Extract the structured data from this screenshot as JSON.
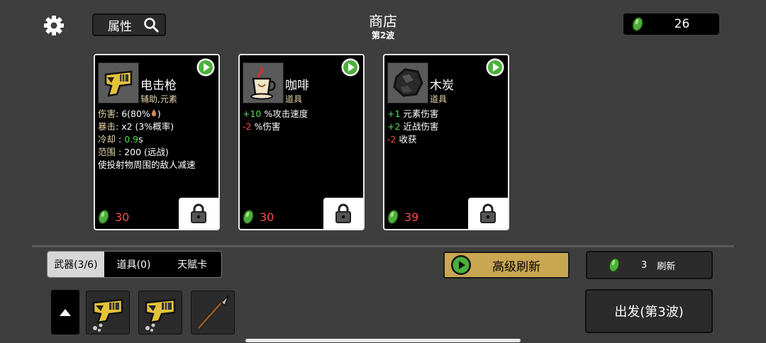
{
  "header": {
    "attributes_label": "属性",
    "title": "商店",
    "wave": "第2波",
    "materials": "26"
  },
  "cards": [
    {
      "name": "电击枪",
      "category": "辅助,元素",
      "stats": [
        {
          "parts": [
            {
              "t": "伤害",
              "c": "lbl"
            },
            {
              "t": ": 6(80%",
              "c": ""
            }
          ]
        },
        {
          "parts": [
            {
              "t": "暴击",
              "c": "lbl"
            },
            {
              "t": ": x2 (3%概率)",
              "c": ""
            }
          ]
        },
        {
          "parts": [
            {
              "t": "冷却",
              "c": "lbl"
            },
            {
              "t": " : ",
              "c": ""
            },
            {
              "t": "0.9",
              "c": "pos"
            },
            {
              "t": "s",
              "c": ""
            }
          ]
        },
        {
          "parts": [
            {
              "t": "范围",
              "c": "lbl"
            },
            {
              "t": " : 200 (远战)",
              "c": ""
            }
          ]
        },
        {
          "parts": [
            {
              "t": "使投射物周围的敌人减速",
              "c": ""
            }
          ]
        }
      ],
      "price": "30",
      "icon": "taser-icon"
    },
    {
      "name": "咖啡",
      "category": "道具",
      "stats": [
        {
          "parts": [
            {
              "t": "+10",
              "c": "pos"
            },
            {
              "t": " %攻击速度",
              "c": ""
            }
          ]
        },
        {
          "parts": [
            {
              "t": "-2",
              "c": "neg"
            },
            {
              "t": " %伤害",
              "c": ""
            }
          ]
        }
      ],
      "price": "30",
      "icon": "coffee-cup-icon"
    },
    {
      "name": "木炭",
      "category": "道具",
      "stats": [
        {
          "parts": [
            {
              "t": "+1",
              "c": "pos"
            },
            {
              "t": " 元素伤害",
              "c": ""
            }
          ]
        },
        {
          "parts": [
            {
              "t": "+2",
              "c": "pos"
            },
            {
              "t": " 近战伤害",
              "c": ""
            }
          ]
        },
        {
          "parts": [
            {
              "t": "-2",
              "c": "neg"
            },
            {
              "t": " 收获",
              "c": ""
            }
          ]
        }
      ],
      "price": "39",
      "icon": "charcoal-icon"
    }
  ],
  "tabs": [
    {
      "label": "武器(3/6)",
      "active": true
    },
    {
      "label": "道具(0)",
      "active": false
    },
    {
      "label": "天赋卡",
      "active": false
    }
  ],
  "advanced_refresh_label": "高级刷新",
  "refresh": {
    "cost": "3",
    "label": "刷新"
  },
  "go_label": "出发(第3波)",
  "inventory": [
    "taser-icon",
    "taser-icon",
    "spear-icon"
  ],
  "colors": {
    "background": "#3e3e3e",
    "accent_gold": "#c9a651",
    "positive": "#5bd85b",
    "negative": "#ff4a4a",
    "material_green": "#4caf3c"
  }
}
